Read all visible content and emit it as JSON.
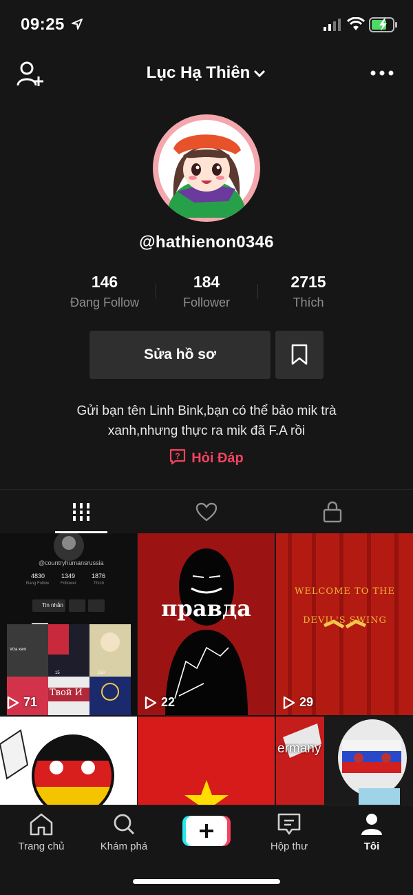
{
  "status_bar": {
    "time": "09:25"
  },
  "header": {
    "title": "Lục Hạ Thiên"
  },
  "profile": {
    "username": "@hathienon0346",
    "stats": [
      {
        "value": "146",
        "label": "Đang Follow"
      },
      {
        "value": "184",
        "label": "Follower"
      },
      {
        "value": "2715",
        "label": "Thích"
      }
    ],
    "edit_label": "Sửa hồ sơ",
    "bio_line1": "Gửi bạn tên Linh Bink,bạn có thể bảo mik trà",
    "bio_line2": "xanh,nhưng thực ra mik đã F.A rồi",
    "qa_label": "Hỏi Đáp"
  },
  "videos": [
    {
      "views": "71",
      "inner": {
        "handle": "@countryhumansrussia",
        "stats": [
          "4830",
          "1349",
          "1876"
        ],
        "labels": [
          "Đang Follow",
          "Follower",
          "Thích"
        ],
        "button": "Tin nhắn",
        "thumb_caption": "Vừa xem",
        "thumb_views": [
          "15",
          "150"
        ],
        "banner": "Твой И"
      }
    },
    {
      "views": "22",
      "overlay_text": "правда"
    },
    {
      "views": "29",
      "overlay_text": "WELCOME TO THE DEVIL'S SWING"
    },
    {
      "views": ""
    },
    {
      "views": ""
    },
    {
      "views": "",
      "overlay_text": "ermany"
    }
  ],
  "tabbar": {
    "items": [
      {
        "label": "Trang chủ",
        "icon": "home-icon"
      },
      {
        "label": "Khám phá",
        "icon": "search-icon"
      },
      {
        "label": "",
        "icon": "plus-icon"
      },
      {
        "label": "Hộp thư",
        "icon": "inbox-icon"
      },
      {
        "label": "Tôi",
        "icon": "profile-icon"
      }
    ]
  },
  "colors": {
    "accent": "#f2435f",
    "background": "#161616",
    "button": "#2f2f2f"
  }
}
